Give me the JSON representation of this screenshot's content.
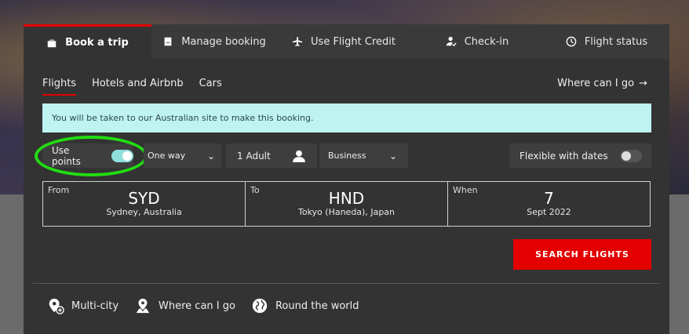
{
  "tabs": [
    {
      "label": "Book a trip",
      "icon": "briefcase-icon",
      "active": true
    },
    {
      "label": "Manage booking",
      "icon": "document-icon"
    },
    {
      "label": "Use Flight Credit",
      "icon": "plane-icon"
    },
    {
      "label": "Check-in",
      "icon": "person-check-icon"
    },
    {
      "label": "Flight status",
      "icon": "clock-icon"
    }
  ],
  "subnav": {
    "items": [
      "Flights",
      "Hotels and Airbnb",
      "Cars"
    ],
    "where_link": "Where can I go"
  },
  "notice": "You will be taken to our Australian site to make this booking.",
  "controls": {
    "use_points_label": "Use points",
    "use_points_on": true,
    "trip_type": "One way",
    "passengers": "1 Adult",
    "cabin": "Business",
    "flexible_label": "Flexible with dates",
    "flexible_on": false
  },
  "route": {
    "from": {
      "label": "From",
      "code": "SYD",
      "city": "Sydney, Australia"
    },
    "to": {
      "label": "To",
      "code": "HND",
      "city": "Tokyo (Haneda), Japan"
    },
    "when": {
      "label": "When",
      "day": "7",
      "month": "Sept 2022"
    }
  },
  "search_button": "SEARCH FLIGHTS",
  "bottom_links": [
    "Multi-city",
    "Where can I go",
    "Round the world"
  ],
  "colors": {
    "accent": "#e40000",
    "toggle_on": "#8fe0dd",
    "highlight": "#22dd11"
  }
}
